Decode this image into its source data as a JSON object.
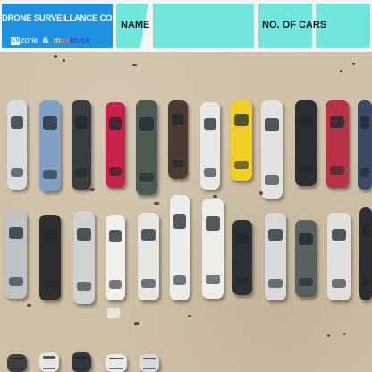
{
  "header": {
    "contest_title": "DRONE SURVEILLANCE CONTEST",
    "brand_cv_mark": "CV",
    "brand_cv_text": "zone",
    "brand_ampersand": "&",
    "brand_mb_a": "m",
    "brand_mb_b": "aa",
    "brand_mb_c": "block",
    "name_label": "NAME",
    "name_value": "",
    "cars_label": "NO. OF CARS",
    "cars_value": ""
  },
  "colors": {
    "contest_panel": "#1f93e2",
    "field_cyan": "#70e6dc",
    "ground": "#cfc0a8"
  }
}
